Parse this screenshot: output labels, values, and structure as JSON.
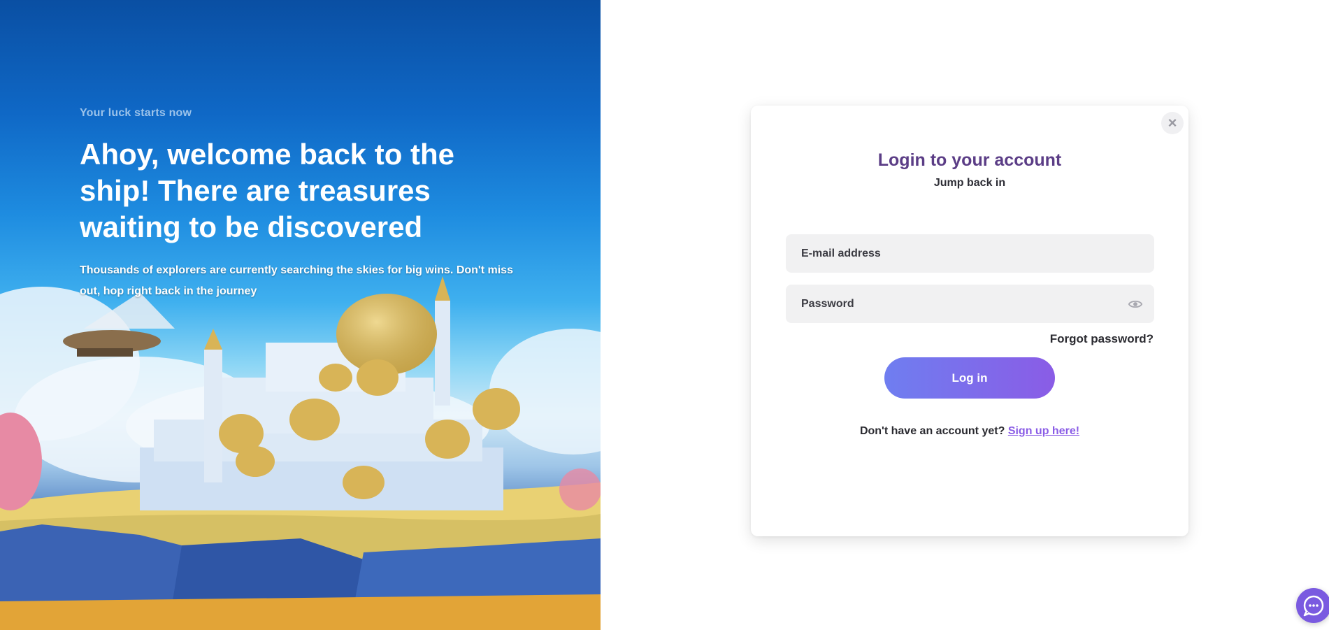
{
  "hero": {
    "eyebrow": "Your luck starts now",
    "title": "Ahoy, welcome back to the ship! There are treasures waiting to be discovered",
    "subtitle": "Thousands of explorers are currently searching the skies for big wins. Don't miss out, hop right back in the journey"
  },
  "modal": {
    "close_icon": "close-icon",
    "title": "Login to your account",
    "subtitle": "Jump back in",
    "email_placeholder": "E-mail address",
    "password_placeholder": "Password",
    "password_toggle_icon": "eye-icon",
    "forgot_password": "Forgot password?",
    "login_button": "Log in",
    "signup_prompt": "Don't have an account yet?",
    "signup_link": "Sign up here!"
  },
  "chat": {
    "icon": "chat-icon"
  },
  "colors": {
    "accent_purple": "#8a5ce6",
    "title_purple": "#5b3d86",
    "button_gradient_start": "#6f7ef0",
    "button_gradient_end": "#8a5ce6",
    "hero_blue": "#0f68c6"
  }
}
